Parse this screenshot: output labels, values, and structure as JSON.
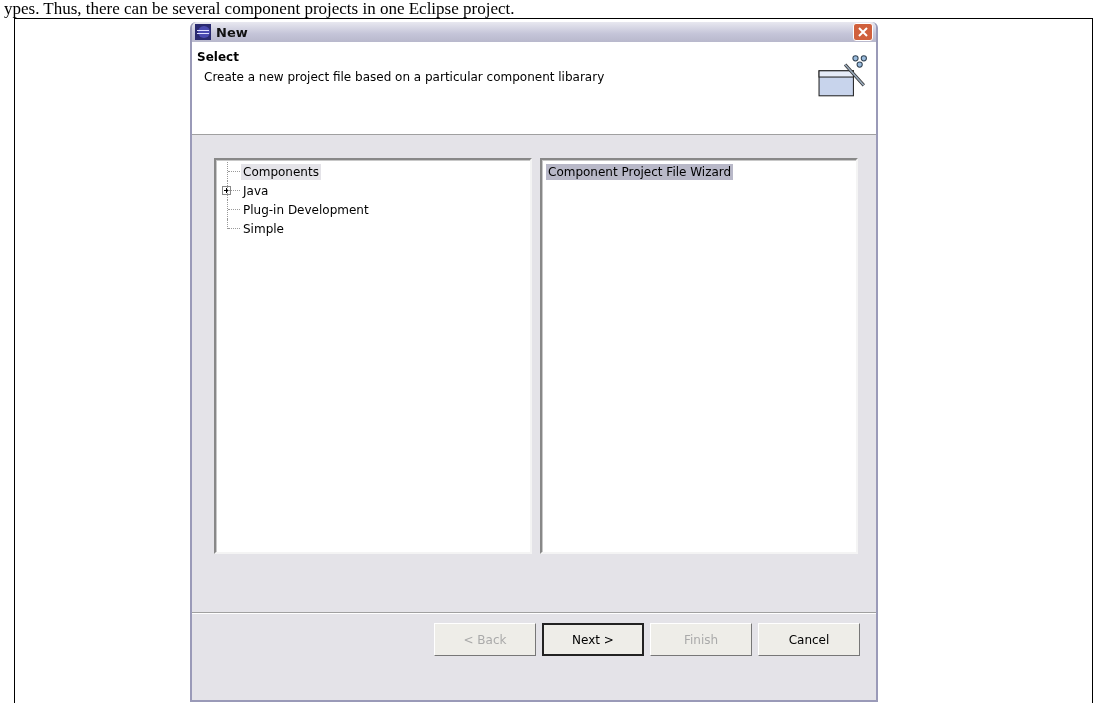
{
  "document_text": "ypes. Thus, there can be several component projects in one Eclipse project.",
  "window": {
    "title": "New"
  },
  "header": {
    "title": "Select",
    "description": "Create a new project file based on a particular component libarary"
  },
  "tree": [
    {
      "label": "Components",
      "selected": true
    },
    {
      "label": "Java",
      "selected": false,
      "expanded": false
    },
    {
      "label": "Plug-in Development",
      "selected": false
    },
    {
      "label": "Simple",
      "selected": false
    }
  ],
  "wizards": [
    {
      "label": "Component Project File Wizard",
      "selected": true
    }
  ],
  "buttons": [
    {
      "label": "< Back",
      "disabled": true,
      "default": false
    },
    {
      "label": "Next >",
      "disabled": false,
      "default": true
    },
    {
      "label": "Finish",
      "disabled": true,
      "default": false
    },
    {
      "label": "Cancel",
      "disabled": false,
      "default": false
    }
  ]
}
